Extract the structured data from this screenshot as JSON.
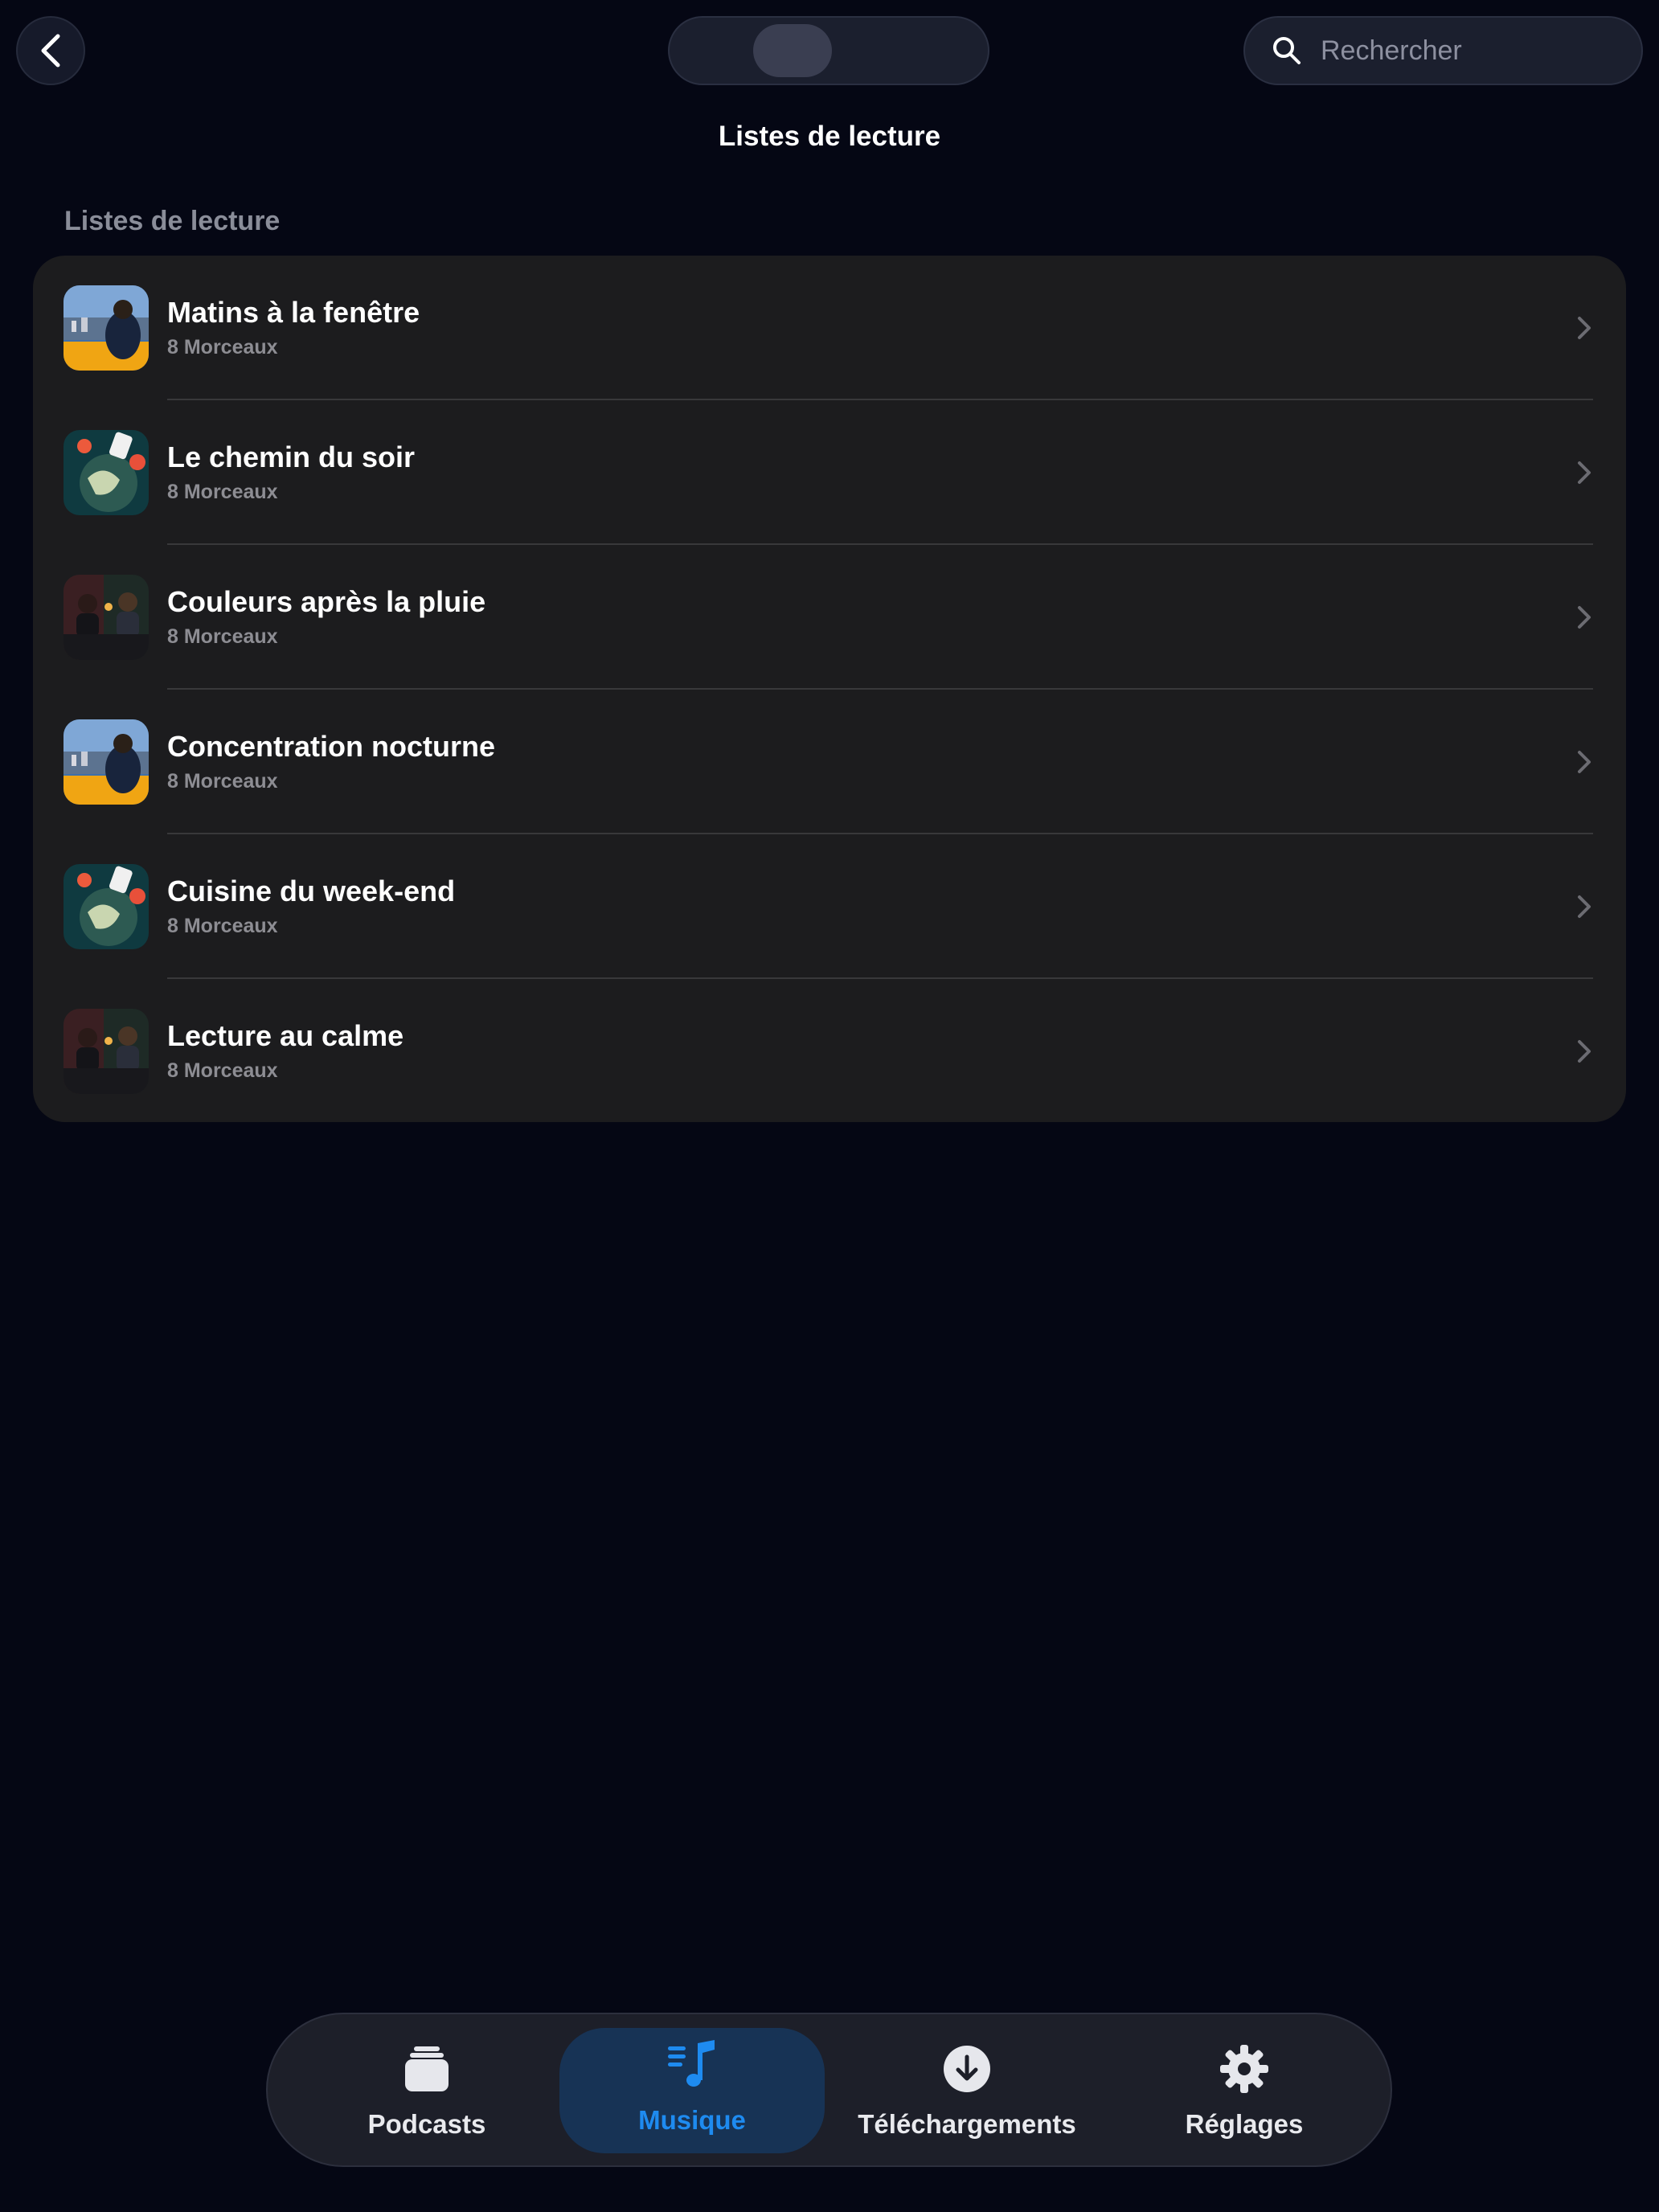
{
  "header": {
    "title": "Listes de lecture",
    "search_placeholder": "Rechercher"
  },
  "section": {
    "title": "Listes de lecture"
  },
  "playlists": [
    {
      "title": "Matins à la fenêtre",
      "subtitle": "8 Morceaux",
      "artwork": "window-city-art"
    },
    {
      "title": "Le chemin du soir",
      "subtitle": "8 Morceaux",
      "artwork": "space-globe-art"
    },
    {
      "title": "Couleurs après la pluie",
      "subtitle": "8 Morceaux",
      "artwork": "dinner-table-art"
    },
    {
      "title": "Concentration nocturne",
      "subtitle": "8 Morceaux",
      "artwork": "window-city-art"
    },
    {
      "title": "Cuisine du week-end",
      "subtitle": "8 Morceaux",
      "artwork": "space-globe-art"
    },
    {
      "title": "Lecture au calme",
      "subtitle": "8 Morceaux",
      "artwork": "dinner-table-art"
    }
  ],
  "tabbar": {
    "tabs": [
      {
        "label": "Podcasts",
        "icon": "podcasts-stack-icon",
        "active": false
      },
      {
        "label": "Musique",
        "icon": "music-list-icon",
        "active": true
      },
      {
        "label": "Téléchargements",
        "icon": "download-circle-icon",
        "active": false
      },
      {
        "label": "Réglages",
        "icon": "gear-icon",
        "active": false
      }
    ]
  },
  "colors": {
    "background": "#050714",
    "card": "#1c1c1e",
    "accent": "#1e8bf0",
    "active_tab_bg": "#173355"
  }
}
